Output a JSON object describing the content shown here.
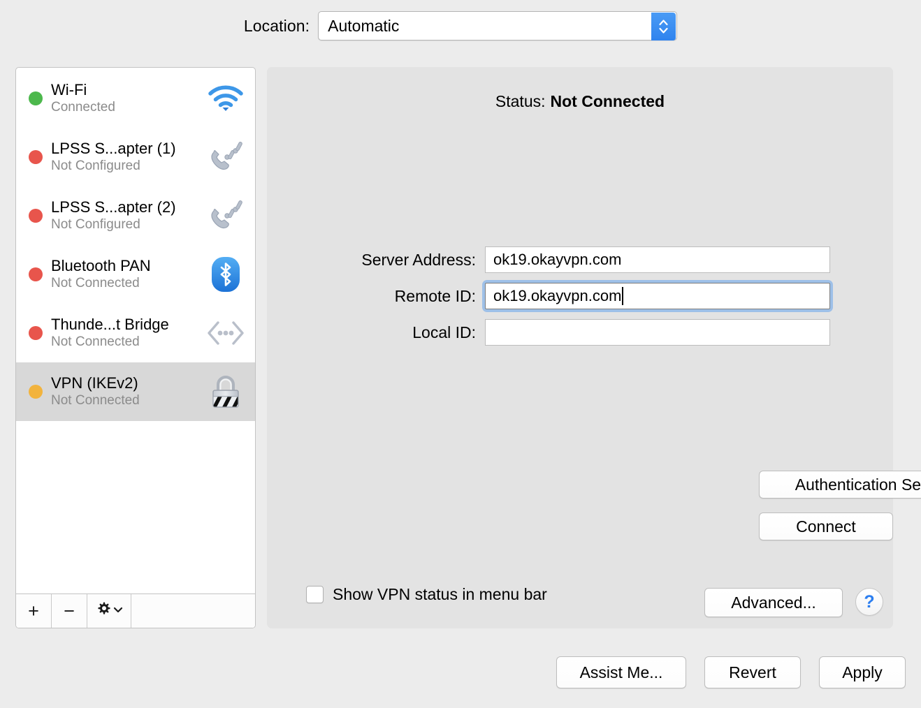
{
  "location": {
    "label": "Location:",
    "selected": "Automatic",
    "options": [
      "Automatic"
    ],
    "stepper_icon": "stepper-up-down-icon"
  },
  "sidebar": {
    "services": [
      {
        "name": "Wi-Fi",
        "status": "Connected",
        "dot_color": "#4cb84c",
        "icon": "wifi-icon",
        "selected": false
      },
      {
        "name": "LPSS S...apter (1)",
        "status": "Not Configured",
        "dot_color": "#e8554c",
        "icon": "modem-phone-icon",
        "selected": false
      },
      {
        "name": "LPSS S...apter (2)",
        "status": "Not Configured",
        "dot_color": "#e8554c",
        "icon": "modem-phone-icon",
        "selected": false
      },
      {
        "name": "Bluetooth PAN",
        "status": "Not Connected",
        "dot_color": "#e8554c",
        "icon": "bluetooth-icon",
        "selected": false
      },
      {
        "name": "Thunde...t Bridge",
        "status": "Not Connected",
        "dot_color": "#e8554c",
        "icon": "thunderbolt-bridge-icon",
        "selected": false
      },
      {
        "name": "VPN (IKEv2)",
        "status": "Not Connected",
        "dot_color": "#f2b33d",
        "icon": "vpn-lock-icon",
        "selected": true
      }
    ],
    "toolbar": {
      "add_label": "+",
      "remove_label": "−",
      "gear_label": "gear-icon",
      "gear_chevron": "chevron-down-icon"
    }
  },
  "panel": {
    "status_label": "Status:",
    "status_value": "Not Connected",
    "fields": [
      {
        "label": "Server Address:",
        "value": "ok19.okayvpn.com",
        "focused": false
      },
      {
        "label": "Remote ID:",
        "value": "ok19.okayvpn.com",
        "focused": true
      },
      {
        "label": "Local ID:",
        "value": "",
        "focused": false
      }
    ],
    "auth_settings_button": "Authentication Settings...",
    "connect_button": "Connect",
    "show_status_checkbox_label": "Show VPN status in menu bar",
    "show_status_checked": false,
    "advanced_button": "Advanced...",
    "help_button": "?"
  },
  "footer": {
    "assist_button": "Assist Me...",
    "revert_button": "Revert",
    "apply_button": "Apply"
  },
  "colors": {
    "window_background": "#ececec",
    "panel_background": "#e3e3e3",
    "selection": "#d8d8d8",
    "accent_blue": "#2f83ee",
    "focus_ring": "#9ec0e8",
    "muted_text": "#8b8b8b"
  }
}
